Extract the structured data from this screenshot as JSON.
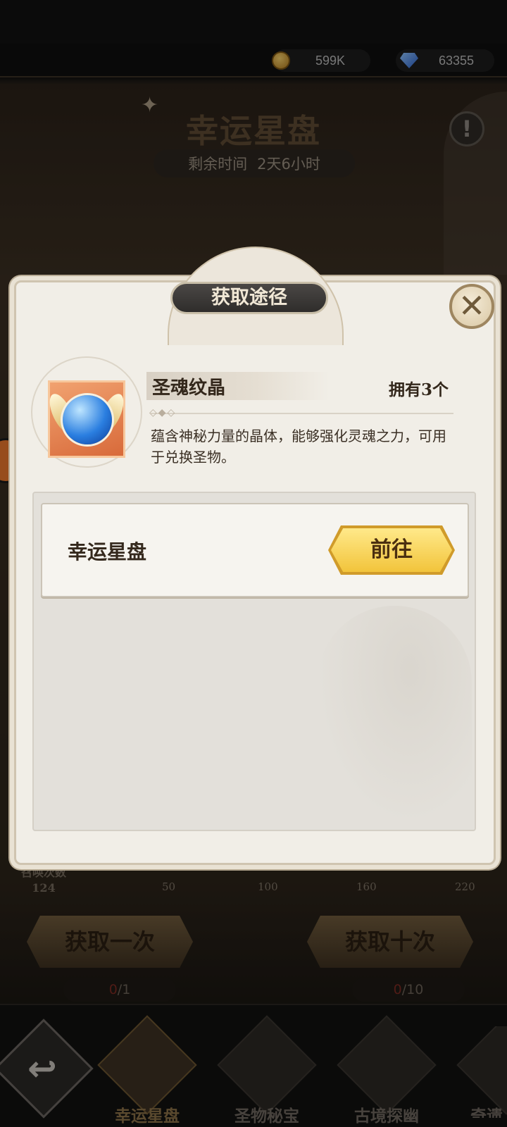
{
  "resources": {
    "gold": {
      "icon": "gold-coin-icon",
      "value": "599K"
    },
    "gems": {
      "icon": "diamond-gem-icon",
      "value": "63355"
    }
  },
  "event": {
    "title": "幸运星盘",
    "timer_label": "剩余时间",
    "timer_value": "2天6小时",
    "info_glyph": "!"
  },
  "progress": {
    "label_line1": "召唤次数",
    "count": "124",
    "milestones": [
      "50",
      "100",
      "160",
      "220"
    ]
  },
  "actions": {
    "single": {
      "label": "获取一次",
      "cost_used": "0",
      "cost_total": "/1"
    },
    "ten": {
      "label": "获取十次",
      "cost_used": "0",
      "cost_total": "/10"
    }
  },
  "bottom_nav": {
    "back_glyph": "↩",
    "tabs": [
      {
        "label": "幸运星盘",
        "active": true
      },
      {
        "label": "圣物秘宝",
        "active": false
      },
      {
        "label": "古境探幽",
        "active": false
      },
      {
        "label": "奇遗",
        "active": false
      }
    ]
  },
  "dialog": {
    "title": "获取途径",
    "close_glyph": "✕",
    "item": {
      "name": "圣魂纹晶",
      "owned": "拥有3个",
      "description": "蕴含神秘力量的晶体，能够强化灵魂之力，可用于兑换圣物。",
      "icon": "soul-crystal-icon"
    },
    "routes": [
      {
        "name": "幸运星盘",
        "button": "前往"
      }
    ]
  },
  "colors": {
    "accent_gold": "#f2c43b",
    "dialog_bg": "#f1eee7",
    "header_dark": "#2f2d2b"
  }
}
